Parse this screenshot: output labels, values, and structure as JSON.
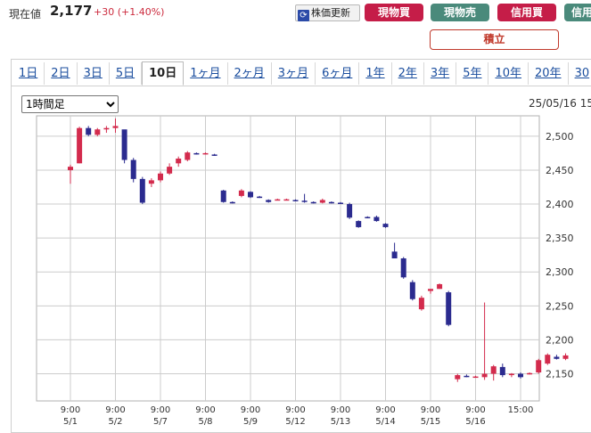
{
  "header": {
    "price_label": "現在値",
    "price_value": "2,177",
    "price_change": "+30 (+1.40%)",
    "refresh_icon": "refresh-icon",
    "refresh_label": "株価更新",
    "buttons": {
      "genbutsu_buy": "現物買",
      "genbutsu_sell": "現物売",
      "shinyo_buy": "信用買",
      "shinyo_sell": "信用",
      "tsumitate": "積立"
    },
    "colors": {
      "buy": "#c51d48",
      "sell": "#4a8a7b",
      "up_candle": "#d32b4d",
      "down_candle": "#2b2b8f"
    }
  },
  "tabs": [
    {
      "label": "1日",
      "active": false
    },
    {
      "label": "2日",
      "active": false
    },
    {
      "label": "3日",
      "active": false
    },
    {
      "label": "5日",
      "active": false
    },
    {
      "label": "10日",
      "active": true
    },
    {
      "label": "1ヶ月",
      "active": false
    },
    {
      "label": "2ヶ月",
      "active": false
    },
    {
      "label": "3ヶ月",
      "active": false
    },
    {
      "label": "6ヶ月",
      "active": false
    },
    {
      "label": "1年",
      "active": false
    },
    {
      "label": "2年",
      "active": false
    },
    {
      "label": "3年",
      "active": false
    },
    {
      "label": "5年",
      "active": false
    },
    {
      "label": "10年",
      "active": false
    },
    {
      "label": "20年",
      "active": false
    },
    {
      "label": "30",
      "active": false
    }
  ],
  "interval": {
    "selected": "1時間足"
  },
  "chart_datetime": "25/05/16 15",
  "chart_data": {
    "type": "candlestick",
    "ylim": [
      2110,
      2530
    ],
    "yticks": [
      2150,
      2200,
      2250,
      2300,
      2350,
      2400,
      2450,
      2500
    ],
    "ytick_labels": [
      "2,150",
      "2,200",
      "2,250",
      "2,300",
      "2,350",
      "2,400",
      "2,450",
      "2,500"
    ],
    "xticks": [
      {
        "index": 0,
        "time": "9:00",
        "date": "5/1"
      },
      {
        "index": 5,
        "time": "9:00",
        "date": "5/2"
      },
      {
        "index": 10,
        "time": "9:00",
        "date": "5/7"
      },
      {
        "index": 15,
        "time": "9:00",
        "date": "5/8"
      },
      {
        "index": 20,
        "time": "9:00",
        "date": "5/9"
      },
      {
        "index": 25,
        "time": "9:00",
        "date": "5/12"
      },
      {
        "index": 30,
        "time": "9:00",
        "date": "5/13"
      },
      {
        "index": 35,
        "time": "9:00",
        "date": "5/14"
      },
      {
        "index": 40,
        "time": "9:00",
        "date": "5/15"
      },
      {
        "index": 45,
        "time": "9:00",
        "date": "5/16"
      },
      {
        "index": 50,
        "time": "15:00",
        "date": ""
      }
    ],
    "candles": [
      [
        2450,
        2458,
        2430,
        2455
      ],
      [
        2460,
        2514,
        2460,
        2512
      ],
      [
        2512,
        2515,
        2500,
        2502
      ],
      [
        2502,
        2512,
        2500,
        2510
      ],
      [
        2510,
        2515,
        2505,
        2512
      ],
      [
        2512,
        2526,
        2505,
        2515
      ],
      [
        2510,
        2508,
        2460,
        2465
      ],
      [
        2465,
        2468,
        2432,
        2437
      ],
      [
        2437,
        2440,
        2400,
        2402
      ],
      [
        2430,
        2438,
        2425,
        2435
      ],
      [
        2435,
        2448,
        2432,
        2445
      ],
      [
        2445,
        2460,
        2443,
        2455
      ],
      [
        2460,
        2470,
        2455,
        2467
      ],
      [
        2465,
        2478,
        2463,
        2476
      ],
      [
        2475,
        2476,
        2473,
        2474
      ],
      [
        2475,
        2476,
        2473,
        2475
      ],
      [
        2473,
        2474,
        2471,
        2472
      ],
      [
        2420,
        2421,
        2402,
        2403
      ],
      [
        2403,
        2404,
        2401,
        2402
      ],
      [
        2412,
        2422,
        2410,
        2420
      ],
      [
        2418,
        2419,
        2409,
        2410
      ],
      [
        2411,
        2412,
        2409,
        2410
      ],
      [
        2406,
        2407,
        2402,
        2403
      ],
      [
        2407,
        2408,
        2406,
        2407
      ],
      [
        2407,
        2408,
        2406,
        2407
      ],
      [
        2406,
        2407,
        2404,
        2405
      ],
      [
        2405,
        2415,
        2402,
        2404
      ],
      [
        2403,
        2404,
        2401,
        2402
      ],
      [
        2402,
        2408,
        2401,
        2406
      ],
      [
        2403,
        2404,
        2401,
        2402
      ],
      [
        2402,
        2403,
        2400,
        2401
      ],
      [
        2400,
        2402,
        2378,
        2380
      ],
      [
        2375,
        2376,
        2365,
        2366
      ],
      [
        2381,
        2382,
        2379,
        2380
      ],
      [
        2381,
        2383,
        2374,
        2375
      ],
      [
        2371,
        2372,
        2365,
        2366
      ],
      [
        2330,
        2343,
        2320,
        2320
      ],
      [
        2320,
        2322,
        2290,
        2292
      ],
      [
        2285,
        2288,
        2258,
        2260
      ],
      [
        2245,
        2265,
        2243,
        2262
      ],
      [
        2272,
        2275,
        2268,
        2275
      ],
      [
        2275,
        2283,
        2275,
        2282
      ],
      [
        2270,
        2272,
        2220,
        2222
      ],
      [
        2142,
        2150,
        2138,
        2148
      ],
      [
        2147,
        2149,
        2145,
        2146
      ],
      [
        2146,
        2147,
        2145,
        2146
      ],
      [
        2145,
        2255,
        2141,
        2150
      ],
      [
        2150,
        2163,
        2140,
        2161
      ],
      [
        2160,
        2165,
        2145,
        2148
      ],
      [
        2148,
        2151,
        2145,
        2150
      ],
      [
        2150,
        2152,
        2143,
        2145
      ],
      [
        2150,
        2152,
        2149,
        2151
      ],
      [
        2152,
        2172,
        2150,
        2170
      ],
      [
        2165,
        2180,
        2163,
        2178
      ],
      [
        2175,
        2178,
        2171,
        2172
      ],
      [
        2172,
        2180,
        2170,
        2177
      ]
    ],
    "grid": true,
    "up_color": "#d32b4d",
    "down_color": "#2b2b8f"
  }
}
